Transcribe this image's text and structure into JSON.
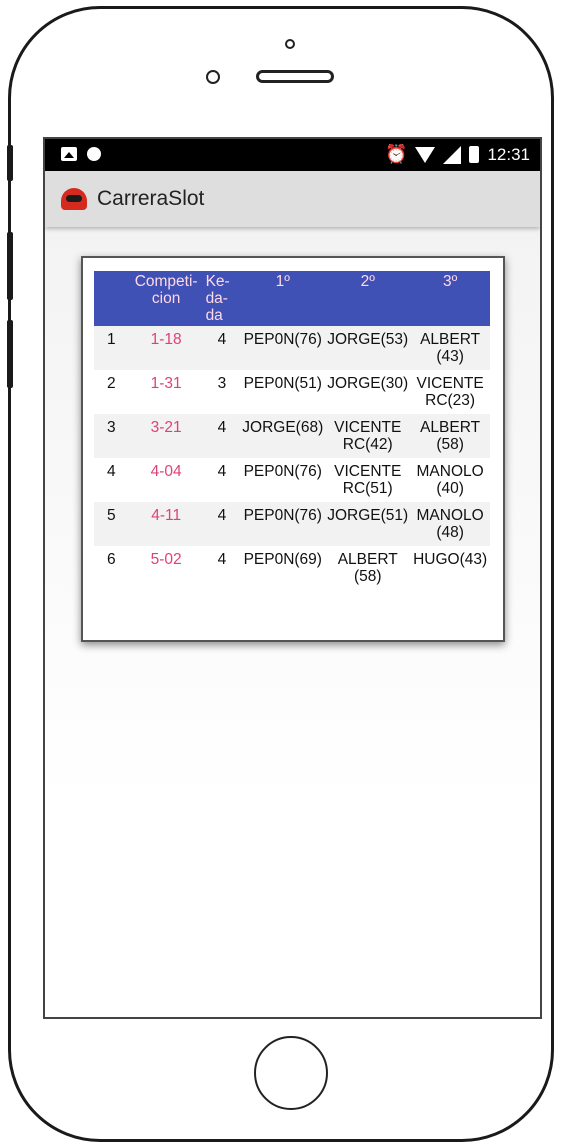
{
  "status_bar": {
    "time": "12:31",
    "icons": [
      "image-icon",
      "circle-icon",
      "alarm-icon",
      "wifi-icon",
      "signal-icon",
      "battery-icon"
    ]
  },
  "app_bar": {
    "title": "CarreraSlot",
    "logo": "helmet-icon"
  },
  "table": {
    "headers": [
      "",
      "Competi-\ncion",
      "Ke-\nda-\nda",
      "1º",
      "2º",
      "3º"
    ],
    "rows": [
      {
        "n": "1",
        "comp": "1-18",
        "kedada": "4",
        "p1": "PEP0N(76)",
        "p2": "JORGE(53)",
        "p3": "ALBERT (43)"
      },
      {
        "n": "2",
        "comp": "1-31",
        "kedada": "3",
        "p1": "PEP0N(51)",
        "p2": "JORGE(30)",
        "p3": "VICENTE RC(23)"
      },
      {
        "n": "3",
        "comp": "3-21",
        "kedada": "4",
        "p1": "JORGE(68)",
        "p2": "VICENTE RC(42)",
        "p3": "ALBERT (58)"
      },
      {
        "n": "4",
        "comp": "4-04",
        "kedada": "4",
        "p1": "PEP0N(76)",
        "p2": "VICENTE RC(51)",
        "p3": "MANOLO (40)"
      },
      {
        "n": "5",
        "comp": "4-11",
        "kedada": "4",
        "p1": "PEP0N(76)",
        "p2": "JORGE(51)",
        "p3": "MANOLO (48)"
      },
      {
        "n": "6",
        "comp": "5-02",
        "kedada": "4",
        "p1": "PEP0N(69)",
        "p2": "ALBERT (58)",
        "p3": "HUGO(43)"
      }
    ]
  },
  "colors": {
    "header_bg": "#3f51b5",
    "header_text": "#ffd8e6",
    "competition_text": "#e0407a",
    "app_bar_bg": "#dedede"
  }
}
